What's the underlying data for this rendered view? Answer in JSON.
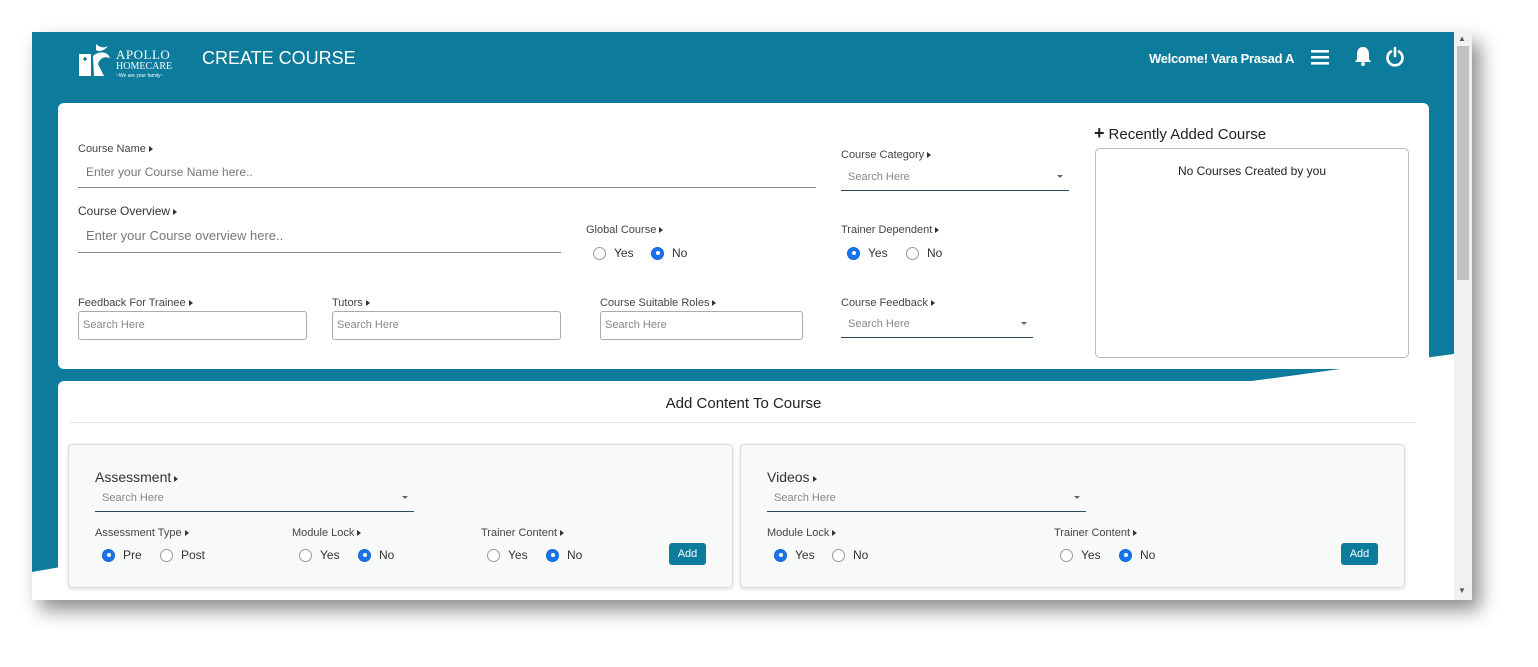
{
  "header": {
    "logo_line1": "APOLLO",
    "logo_line2": "HOMECARE",
    "logo_tagline": "~We are your family~",
    "title": "CREATE COURSE",
    "welcome": "Welcome! Vara Prasad A",
    "icons": [
      "hamburger-icon",
      "bell-icon",
      "power-icon"
    ]
  },
  "course_form": {
    "course_name_label": "Course Name",
    "course_name_placeholder": "Enter your Course Name here..",
    "course_category_label": "Course Category",
    "course_category_placeholder": "Search Here",
    "course_overview_label": "Course Overview",
    "course_overview_placeholder": "Enter your Course overview here..",
    "global_course_label": "Global Course",
    "global_course_options": [
      "Yes",
      "No"
    ],
    "global_course_selected": "No",
    "trainer_dependent_label": "Trainer Dependent",
    "trainer_dependent_options": [
      "Yes",
      "No"
    ],
    "trainer_dependent_selected": "Yes",
    "feedback_trainee_label": "Feedback For Trainee",
    "feedback_trainee_placeholder": "Search Here",
    "tutors_label": "Tutors",
    "tutors_placeholder": "Search Here",
    "suitable_roles_label": "Course Suitable Roles",
    "suitable_roles_placeholder": "Search Here",
    "course_feedback_label": "Course Feedback",
    "course_feedback_placeholder": "Search Here"
  },
  "recent": {
    "title": "Recently Added Course",
    "empty_text": "No Courses Created by you"
  },
  "content": {
    "title": "Add Content To Course",
    "assessment": {
      "title": "Assessment",
      "search_placeholder": "Search Here",
      "type_label": "Assessment Type",
      "type_options": [
        "Pre",
        "Post"
      ],
      "type_selected": "Pre",
      "module_lock_label": "Module Lock",
      "module_lock_options": [
        "Yes",
        "No"
      ],
      "module_lock_selected": "No",
      "trainer_content_label": "Trainer Content",
      "trainer_content_options": [
        "Yes",
        "No"
      ],
      "trainer_content_selected": "No",
      "add_label": "Add"
    },
    "videos": {
      "title": "Videos",
      "search_placeholder": "Search Here",
      "module_lock_label": "Module Lock",
      "module_lock_options": [
        "Yes",
        "No"
      ],
      "module_lock_selected": "Yes",
      "trainer_content_label": "Trainer Content",
      "trainer_content_options": [
        "Yes",
        "No"
      ],
      "trainer_content_selected": "No",
      "add_label": "Add"
    }
  },
  "colors": {
    "primary": "#0d7b9b",
    "radio_on": "#1a73e8"
  }
}
